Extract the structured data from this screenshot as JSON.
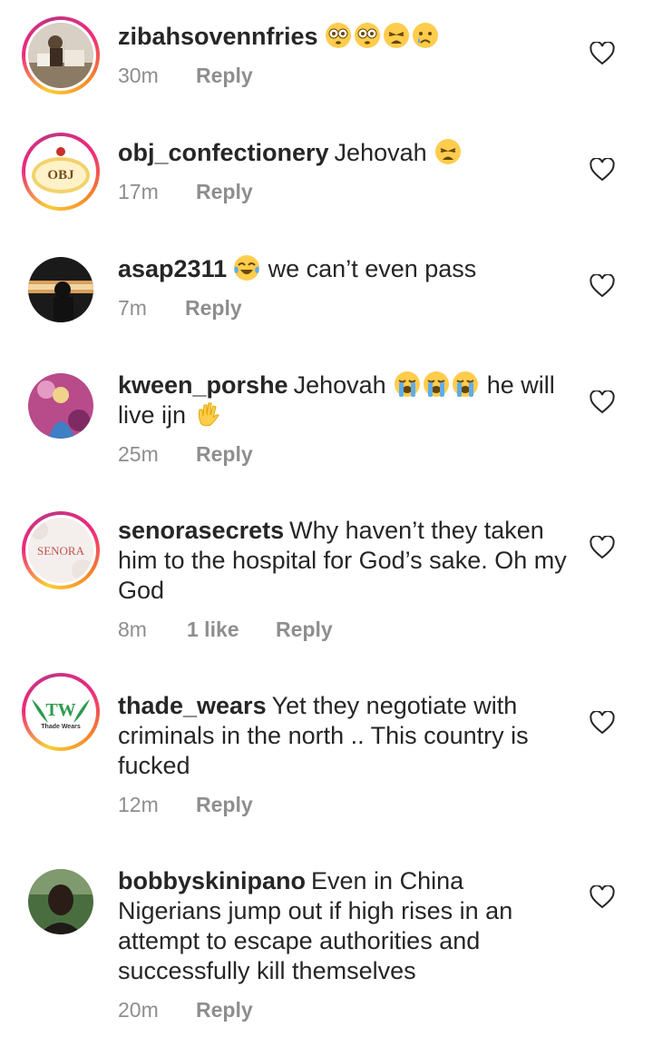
{
  "comments": [
    {
      "username": "zibahsovennfries",
      "text": "",
      "emojis": [
        "flushed-face-emoji",
        "flushed-face-emoji",
        "weary-face-emoji",
        "crying-face-emoji"
      ],
      "time": "30m",
      "reply": "Reply"
    },
    {
      "username": "obj_confectionery",
      "text": "Jehovah",
      "emojis": [
        "weary-face-emoji"
      ],
      "time": "17m",
      "reply": "Reply",
      "avatar_text": "OBJ"
    },
    {
      "username": "asap2311",
      "text_pre": "",
      "emojis_pre": [
        "tears-of-joy-emoji"
      ],
      "text": "we can’t even pass",
      "time": "7m",
      "reply": "Reply"
    },
    {
      "username": "kween_porshe",
      "text": "Jehovah",
      "emojis": [
        "loudly-crying-emoji",
        "loudly-crying-emoji",
        "loudly-crying-emoji"
      ],
      "text2": "he will live ijn",
      "emoji_end": "waving-hand-emoji",
      "time": "25m",
      "reply": "Reply"
    },
    {
      "username": "senorasecrets",
      "text": "Why haven’t they taken him to the hospital for God’s sake. Oh my God",
      "time": "8m",
      "likes": "1 like",
      "reply": "Reply",
      "avatar_text": "SENORA"
    },
    {
      "username": "thade_wears",
      "text": "Yet they negotiate with criminals in the north .. This country is fucked",
      "time": "12m",
      "reply": "Reply",
      "avatar_text": "TW",
      "avatar_sub": "Thade Wears"
    },
    {
      "username": "bobbyskinipano",
      "text": "Even in China Nigerians jump out if high rises in an attempt to escape authorities and successfully kill themselves",
      "time": "20m",
      "reply": "Reply"
    }
  ],
  "colors": {
    "text": "#262626",
    "meta": "#8e8e8e",
    "background": "#ffffff"
  }
}
